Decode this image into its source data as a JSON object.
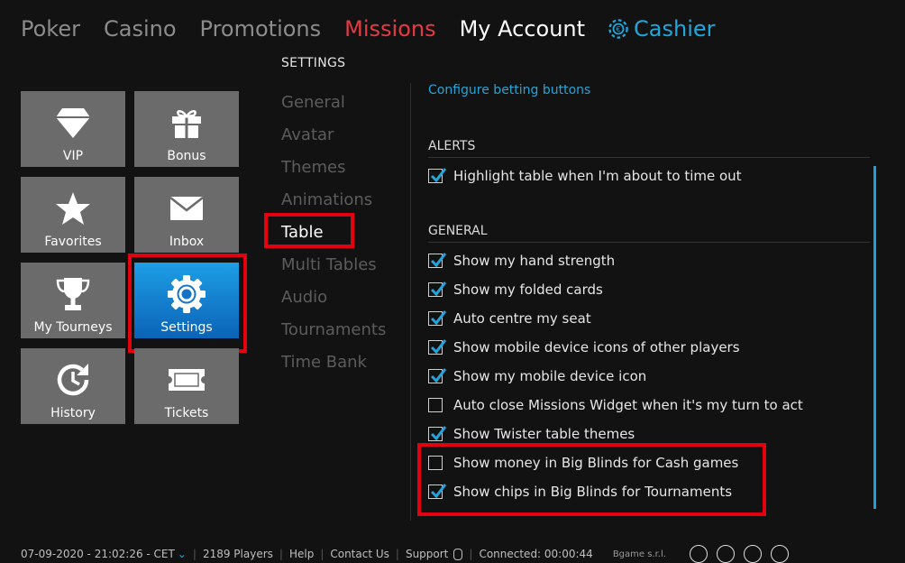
{
  "topnav": {
    "poker": "Poker",
    "casino": "Casino",
    "promotions": "Promotions",
    "missions": "Missions",
    "my_account": "My Account",
    "cashier": "Cashier"
  },
  "tiles": {
    "vip": "VIP",
    "bonus": "Bonus",
    "favorites": "Favorites",
    "inbox": "Inbox",
    "my_tourneys": "My Tourneys",
    "settings": "Settings",
    "history": "History",
    "tickets": "Tickets"
  },
  "settings": {
    "heading": "SETTINGS",
    "menu": [
      "General",
      "Avatar",
      "Themes",
      "Animations",
      "Table",
      "Multi Tables",
      "Audio",
      "Tournaments",
      "Time Bank"
    ],
    "selected": "Table"
  },
  "panel": {
    "config_link": "Configure betting buttons",
    "alerts_title": "ALERTS",
    "alerts": [
      {
        "label": "Highlight table when I'm about to time out",
        "checked": true
      }
    ],
    "general_title": "GENERAL",
    "general": [
      {
        "label": "Show my hand strength",
        "checked": true
      },
      {
        "label": "Show my folded cards",
        "checked": true
      },
      {
        "label": "Auto centre my seat",
        "checked": true
      },
      {
        "label": "Show mobile device icons of other players",
        "checked": true
      },
      {
        "label": "Show my mobile device icon",
        "checked": true
      },
      {
        "label": "Auto close Missions Widget when it's my turn to act",
        "checked": false
      },
      {
        "label": "Show Twister table themes",
        "checked": true
      },
      {
        "label": "Show money in Big Blinds for Cash games",
        "checked": false
      },
      {
        "label": "Show chips in Big Blinds for Tournaments",
        "checked": true
      }
    ]
  },
  "footer": {
    "datetime": "07-09-2020 - 21:02:26 - CET",
    "players": "2189 Players",
    "help": "Help",
    "contact": "Contact Us",
    "support": "Support",
    "connected": "Connected: 00:00:44",
    "brand": "Bgame s.r.l."
  },
  "colors": {
    "accent_blue": "#21a6da",
    "missions_red": "#e53a44",
    "highlight_red": "#e3000f",
    "tile_gray": "#6b6b6b"
  }
}
